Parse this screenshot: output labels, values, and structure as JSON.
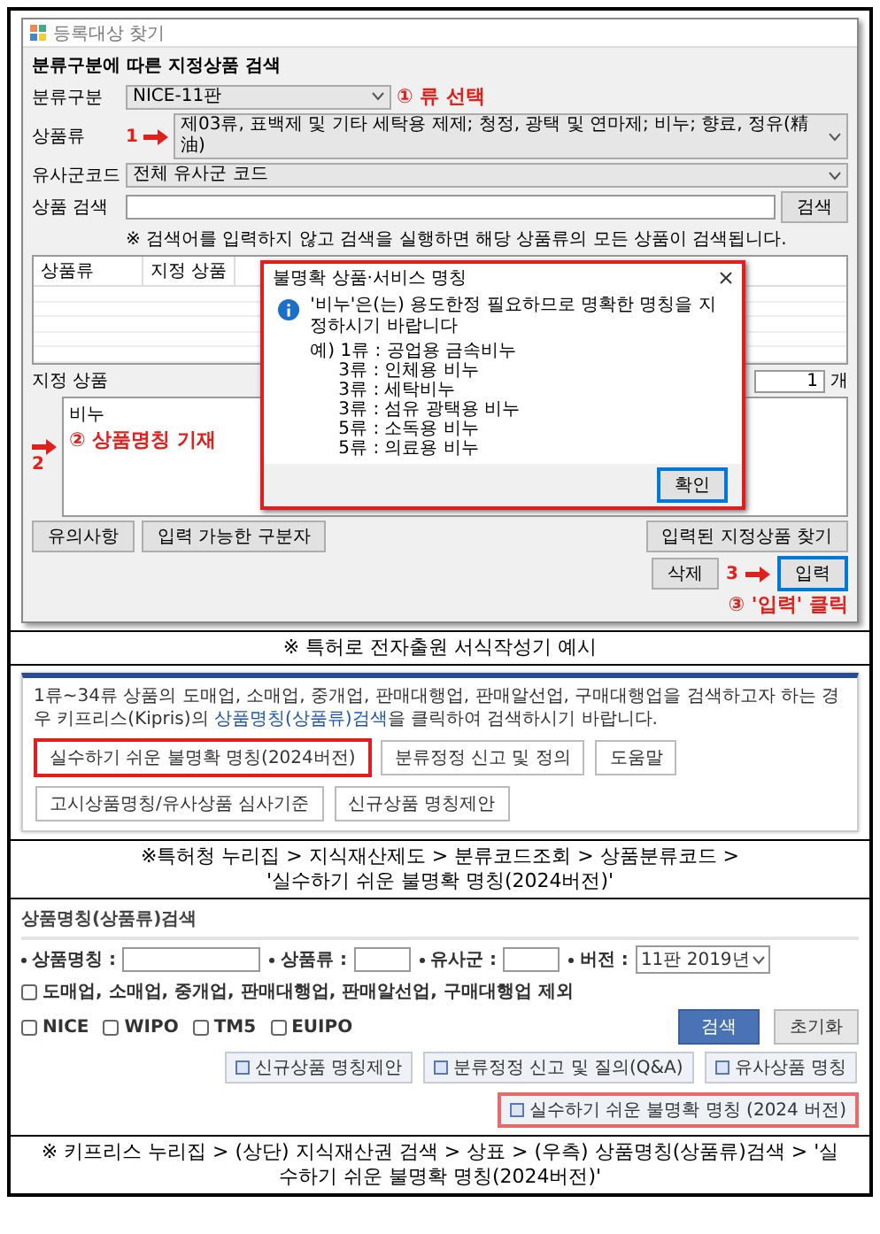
{
  "editor_window": {
    "title": "등록대상 찾기",
    "heading": "분류구분에 따른 지정상품 검색",
    "fields": [
      {
        "label": "분류구분",
        "kind": "select",
        "value": "NICE-11판",
        "annotation": "① 류 선택"
      },
      {
        "label": "상품류",
        "kind": "select",
        "value": "제03류, 표백제 및 기타 세탁용 제제; 청정, 광택 및 연마제; 비누; 향료, 정유(精油)",
        "marker": "1"
      },
      {
        "label": "유사군코드",
        "kind": "select",
        "value": "전체 유사군 코드"
      },
      {
        "label": "상품 검색",
        "kind": "search",
        "button": "검색"
      }
    ],
    "note": "※ 검색어를 입력하지 않고 검색을 실행하면 해당 상품류의 모든 상품이 검색됩니다.",
    "table": {
      "columns": [
        "상품류",
        "지정 상품"
      ]
    },
    "designated": {
      "label": "지정 상품",
      "count": "1",
      "unit": "개",
      "value": "비누",
      "marker": "2",
      "annotation": "② 상품명칭 기재"
    },
    "left_buttons": [
      "유의사항",
      "입력 가능한 구분자"
    ],
    "find_button": "입력된 지정상품 찾기",
    "delete_button": "삭제",
    "input_button": "입력",
    "input_marker": "3",
    "input_annotation": "③ '입력' 클릭",
    "dialog": {
      "title": "불명확 상품·서비스 명칭",
      "message": "'비누'은(는) 용도한정 필요하므로 명확한 명칭을 지정하시기 바랍니다",
      "examples": [
        "예) 1류 : 공업용 금속비누",
        "3류 : 인체용 비누",
        "3류 : 세탁비누",
        "3류 : 섬유 광택용 비누",
        "5류 : 소독용 비누",
        "5류 : 의료용 비누"
      ],
      "ok": "확인"
    }
  },
  "captions": [
    {
      "lines": [
        "※ 특허로 전자출원 서식작성기 예시"
      ]
    },
    {
      "lines": [
        "※특허청 누리집 > 지식재산제도 > 분류코드조회 > 상품분류코드 >",
        "'실수하기 쉬운 불명확 명칭(2024버전)'"
      ]
    },
    {
      "lines": [
        "※ 키프리스 누리집 > (상단) 지식재산권 검색 > 상표 > (우측) 상품명칭(상품류)검색 > '실",
        "수하기 쉬운 불명확 명칭(2024버전)'"
      ]
    }
  ],
  "kipo_panel": {
    "notice_before": "1류~34류 상품의 도매업, 소매업, 중개업, 판매대행업, 판매알선업, 구매대행업을 검색하고자 하는 경우 키프리스(Kipris)의 ",
    "notice_link": "상품명칭(상품류)검색",
    "notice_after": "을 클릭하여 검색하시기 바랍니다.",
    "buttons": [
      {
        "label": "실수하기 쉬운 불명확 명칭(2024버전)",
        "highlighted": true
      },
      {
        "label": "분류정정 신고 및 정의",
        "highlighted": false
      },
      {
        "label": "도움말",
        "highlighted": false
      },
      {
        "label": "고시상품명칭/유사상품 심사기준",
        "highlighted": false
      },
      {
        "label": "신규상품 명칭제안",
        "highlighted": false
      }
    ]
  },
  "kipris_panel": {
    "title": "상품명칭(상품류)검색",
    "fields": [
      {
        "label": "상품명칭 :",
        "kind": "input"
      },
      {
        "label": "상품류 :",
        "kind": "input"
      },
      {
        "label": "유사군 :",
        "kind": "input"
      },
      {
        "label": "버전 :",
        "kind": "select",
        "value": "11판 2019년"
      }
    ],
    "exclude_option": {
      "label": "도매업, 소매업, 중개업, 판매대행업, 판매알선업, 구매대행업 제외",
      "checked": false
    },
    "db_options": [
      {
        "label": "NICE",
        "checked": false
      },
      {
        "label": "WIPO",
        "checked": false
      },
      {
        "label": "TM5",
        "checked": false
      },
      {
        "label": "EUIPO",
        "checked": false
      }
    ],
    "search_button": "검색",
    "reset_button": "초기화",
    "buttons": [
      {
        "label": "신규상품 명칭제안",
        "highlighted": false
      },
      {
        "label": "분류정정 신고 및 질의(Q&A)",
        "highlighted": false
      },
      {
        "label": "유사상품 명칭",
        "highlighted": false
      },
      {
        "label": "실수하기 쉬운 불명확 명칭 (2024 버전)",
        "highlighted": true
      }
    ]
  }
}
